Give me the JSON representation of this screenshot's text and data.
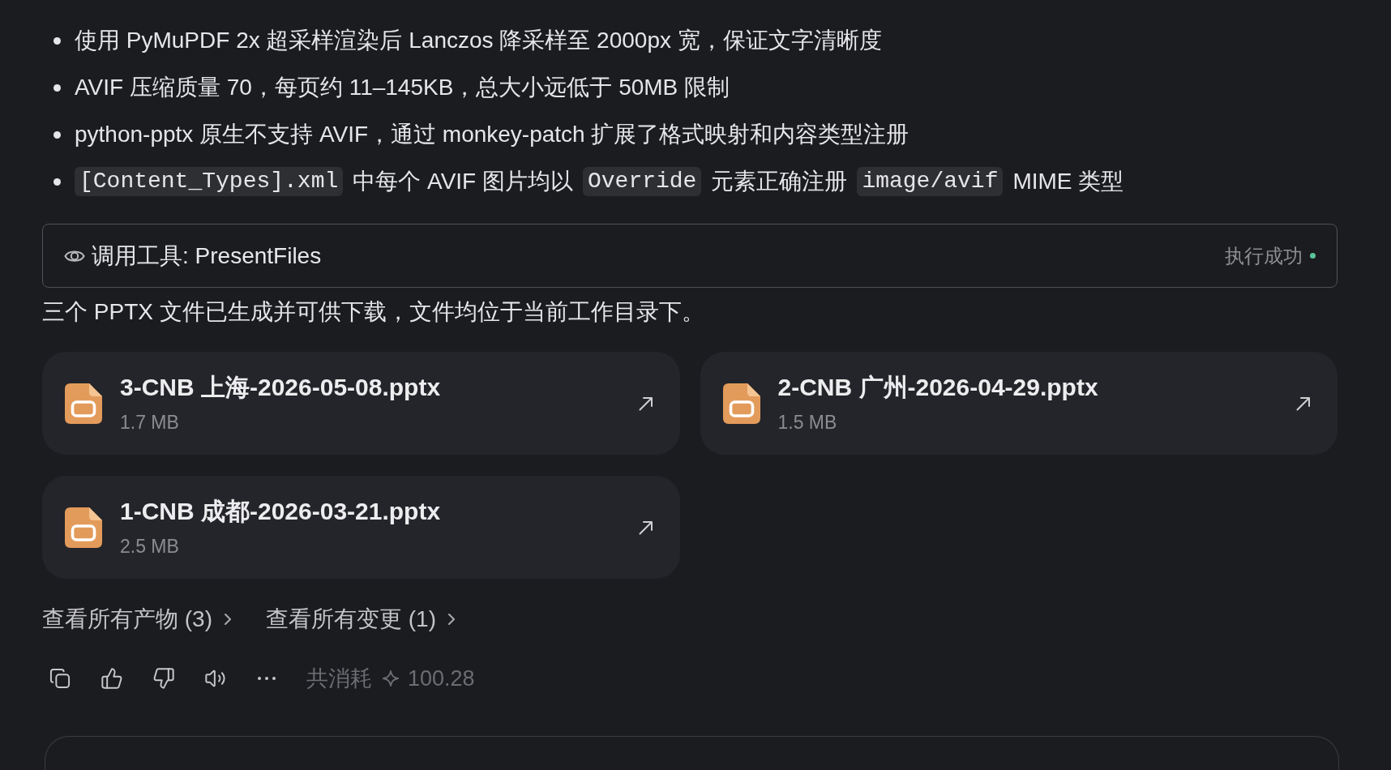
{
  "bullets": [
    {
      "segments": [
        {
          "kind": "text",
          "text": "使用 PyMuPDF 2x 超采样渲染后 Lanczos 降采样至 2000px 宽，保证文字清晰度"
        }
      ]
    },
    {
      "segments": [
        {
          "kind": "text",
          "text": "AVIF 压缩质量 70，每页约 11–145KB，总大小远低于 50MB 限制"
        }
      ]
    },
    {
      "segments": [
        {
          "kind": "text",
          "text": "python-pptx 原生不支持 AVIF，通过 monkey-patch 扩展了格式映射和内容类型注册"
        }
      ]
    },
    {
      "segments": [
        {
          "kind": "code",
          "text": "[Content_Types].xml"
        },
        {
          "kind": "text",
          "text": "中每个 AVIF 图片均以"
        },
        {
          "kind": "code",
          "text": "Override"
        },
        {
          "kind": "text",
          "text": "元素正确注册"
        },
        {
          "kind": "code",
          "text": "image/avif"
        },
        {
          "kind": "text",
          "text": "MIME 类型"
        }
      ]
    }
  ],
  "tool_call": {
    "label": "调用工具: PresentFiles",
    "status": "执行成功",
    "succeeded": true
  },
  "message": "三个 PPTX 文件已生成并可供下载，文件均位于当前工作目录下。",
  "files": [
    {
      "name": "3-CNB 上海-2026-05-08.pptx",
      "size": "1.7 MB"
    },
    {
      "name": "2-CNB 广州-2026-04-29.pptx",
      "size": "1.5 MB"
    },
    {
      "name": "1-CNB 成都-2026-03-21.pptx",
      "size": "2.5 MB"
    }
  ],
  "links": [
    {
      "label": "查看所有产物 (3)"
    },
    {
      "label": "查看所有变更 (1)"
    }
  ],
  "cost": {
    "label": "共消耗",
    "value": "100.28"
  }
}
